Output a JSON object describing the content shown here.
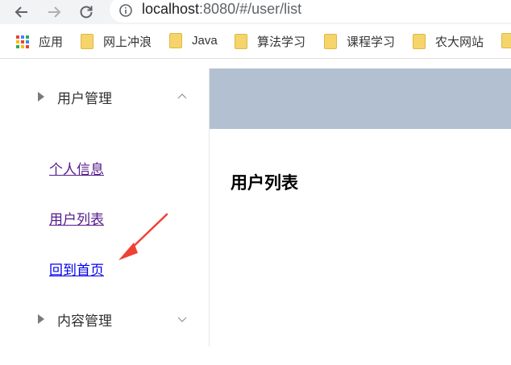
{
  "browser": {
    "url_host": "localhost",
    "url_rest": ":8080/#/user/list"
  },
  "bookmarks": [
    {
      "label": "应用"
    },
    {
      "label": "网上冲浪"
    },
    {
      "label": "Java"
    },
    {
      "label": "算法学习"
    },
    {
      "label": "课程学习"
    },
    {
      "label": "农大网站"
    }
  ],
  "sidebar": {
    "user_menu": {
      "title": "用户管理",
      "items": [
        {
          "label": "个人信息"
        },
        {
          "label": "用户列表"
        },
        {
          "label": "回到首页"
        }
      ]
    },
    "content_menu": {
      "title": "内容管理"
    }
  },
  "main": {
    "title": "用户列表"
  },
  "colors": {
    "header_bg": "#b3c0d1",
    "visited_link": "#551a8b",
    "link": "#0000ee",
    "annotation_arrow": "#f04134"
  }
}
